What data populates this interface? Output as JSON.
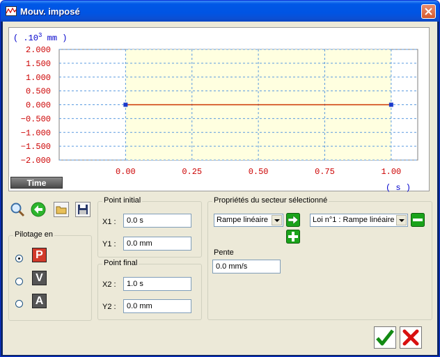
{
  "window": {
    "title": "Mouv. imposé",
    "accent": "#0054e3"
  },
  "chart_data": {
    "type": "line",
    "y_unit_prefix": "( .10",
    "y_unit_exp": "3",
    "y_unit_suffix": " mm )",
    "x_unit": "( s )",
    "yticks": [
      "2.000",
      "1.500",
      "1.000",
      "0.500",
      "0.000",
      "−0.500",
      "−1.000",
      "−1.500",
      "−2.000"
    ],
    "ytick_values": [
      2,
      1.5,
      1,
      0.5,
      0,
      -0.5,
      -1,
      -1.5,
      -2
    ],
    "xticks": [
      "0.00",
      "0.25",
      "0.50",
      "0.75",
      "1.00"
    ],
    "xtick_values": [
      0,
      0.25,
      0.5,
      0.75,
      1.0
    ],
    "xlim": [
      -0.25,
      1.1
    ],
    "ylim": [
      -2,
      2
    ],
    "highlight_range": [
      0,
      1.0
    ],
    "series": [
      {
        "x": [
          0,
          1.0
        ],
        "y": [
          0,
          0
        ],
        "color": "#cc3300"
      }
    ],
    "tick_color": "#cc0000",
    "grid": true
  },
  "time_button": "Time",
  "toolbar": {
    "icons": [
      "zoom-icon",
      "back-arrow-icon",
      "open-folder-icon",
      "save-disk-icon"
    ]
  },
  "pilotage": {
    "title": "Pilotage en",
    "options": [
      {
        "letter": "P",
        "selected": true,
        "color": "#d13a2a"
      },
      {
        "letter": "V",
        "selected": false,
        "color": "#555555"
      },
      {
        "letter": "A",
        "selected": false,
        "color": "#555555"
      }
    ]
  },
  "point_initial": {
    "title": "Point initial",
    "x_label": "X1 :",
    "x_value": "0.0 s",
    "y_label": "Y1 :",
    "y_value": "0.0 mm"
  },
  "point_final": {
    "title": "Point final",
    "x_label": "X2 :",
    "x_value": "1.0 s",
    "y_label": "Y2 :",
    "y_value": "0.0 mm"
  },
  "proprietes": {
    "title": "Propriétés du secteur sélectionné",
    "type_value": "Rampe linéaire",
    "loi_value": "Loi n°1 : Rampe linéaire",
    "pente_label": "Pente",
    "pente_value": "0.0 mm/s"
  },
  "footer": {
    "ok": "check-icon",
    "cancel": "cross-icon"
  }
}
